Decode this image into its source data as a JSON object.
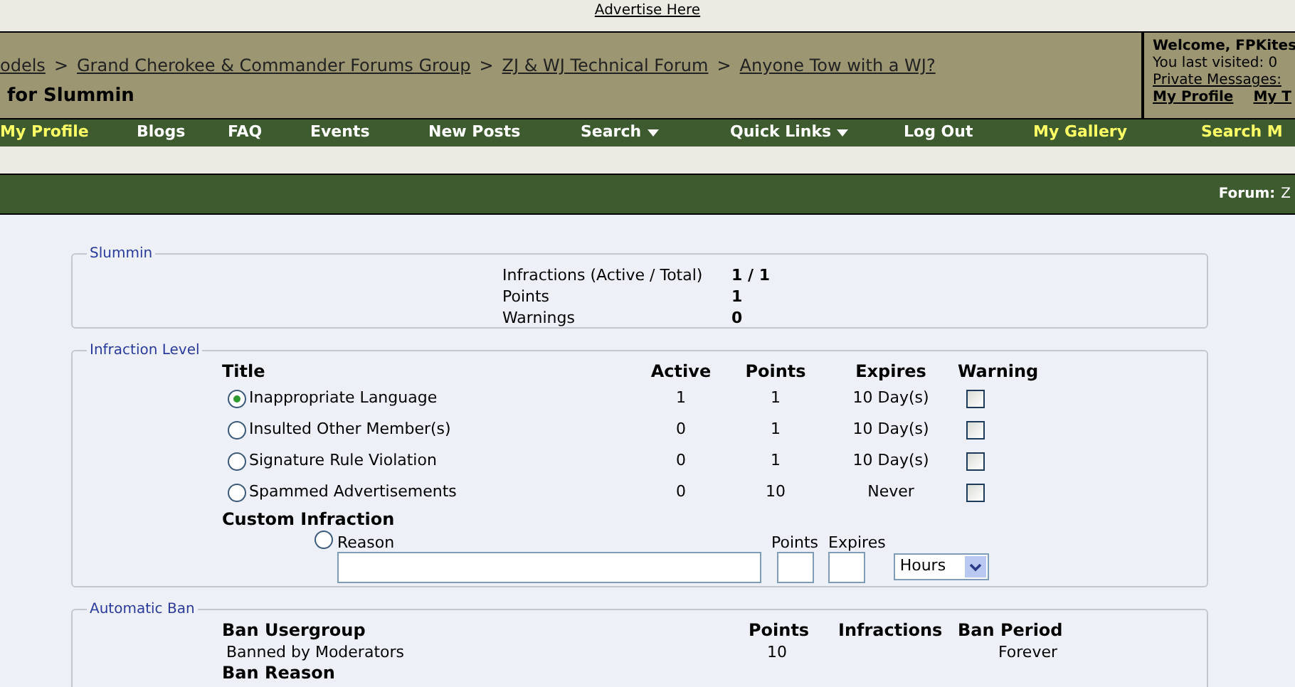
{
  "top_link": "Advertise Here",
  "breadcrumb": {
    "items": [
      "odels",
      "Grand Cherokee & Commander Forums Group",
      "ZJ & WJ Technical Forum",
      "Anyone Tow with a WJ?"
    ],
    "separator": ">",
    "title": "for Slummin"
  },
  "welcome": {
    "greeting": "Welcome, FPKites",
    "last_visited": "You last visited: 0",
    "private_messages": "Private Messages:",
    "links": [
      "My Profile",
      "My T"
    ]
  },
  "navbar": [
    {
      "label": "My Profile",
      "color": "#ffff66",
      "dropdown": false
    },
    {
      "label": "Blogs",
      "color": "#ffffff",
      "dropdown": false
    },
    {
      "label": "FAQ",
      "color": "#ffffff",
      "dropdown": false
    },
    {
      "label": "Events",
      "color": "#ffffff",
      "dropdown": false
    },
    {
      "label": "New Posts",
      "color": "#ffffff",
      "dropdown": false
    },
    {
      "label": "Search",
      "color": "#ffffff",
      "dropdown": true
    },
    {
      "label": "Quick Links",
      "color": "#ffffff",
      "dropdown": true
    },
    {
      "label": "Log Out",
      "color": "#ffffff",
      "dropdown": false
    },
    {
      "label": "My Gallery",
      "color": "#ffff66",
      "dropdown": false
    },
    {
      "label": "Search M",
      "color": "#ffff66",
      "dropdown": false
    }
  ],
  "forum_bar": {
    "label": "Forum:",
    "value": "Z"
  },
  "user_box": {
    "legend": "Slummin",
    "stats": [
      {
        "label": "Infractions (Active / Total)",
        "value": "1 / 1"
      },
      {
        "label": "Points",
        "value": "1"
      },
      {
        "label": "Warnings",
        "value": "0"
      }
    ]
  },
  "infraction_level": {
    "legend": "Infraction Level",
    "columns": [
      "Title",
      "Active",
      "Points",
      "Expires",
      "Warning"
    ],
    "rows": [
      {
        "title": "Inappropriate Language",
        "active": "1",
        "points": "1",
        "expires": "10 Day(s)",
        "selected": true,
        "warning": false
      },
      {
        "title": "Insulted Other Member(s)",
        "active": "0",
        "points": "1",
        "expires": "10 Day(s)",
        "selected": false,
        "warning": false
      },
      {
        "title": "Signature Rule Violation",
        "active": "0",
        "points": "1",
        "expires": "10 Day(s)",
        "selected": false,
        "warning": false
      },
      {
        "title": "Spammed Advertisements",
        "active": "0",
        "points": "10",
        "expires": "Never",
        "selected": false,
        "warning": false
      }
    ],
    "custom": {
      "heading": "Custom Infraction",
      "selected": false,
      "reason_label": "Reason",
      "points_label": "Points",
      "expires_label": "Expires",
      "unit": "Hours"
    }
  },
  "automatic_ban": {
    "legend": "Automatic Ban",
    "columns": [
      "Ban Usergroup",
      "Points",
      "Infractions",
      "Ban Period"
    ],
    "rows": [
      {
        "usergroup": "Banned by Moderators",
        "points": "10",
        "period": "Forever"
      }
    ],
    "reason_heading": "Ban Reason"
  }
}
